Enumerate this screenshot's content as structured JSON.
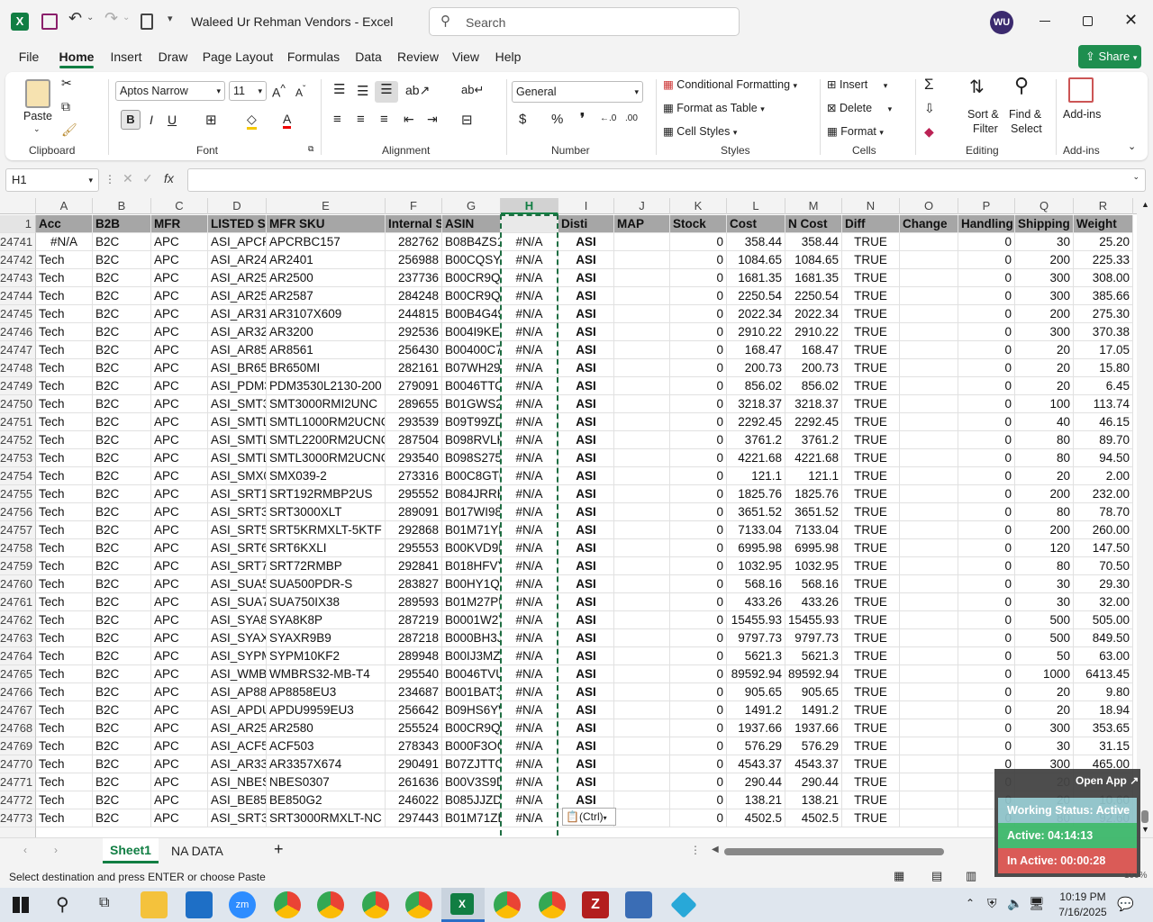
{
  "title": {
    "doc": "Waleed Ur Rehman Vendors  -  Excel",
    "search": "Search",
    "user": "WU"
  },
  "tabs": [
    "File",
    "Home",
    "Insert",
    "Draw",
    "Page Layout",
    "Formulas",
    "Data",
    "Review",
    "View",
    "Help"
  ],
  "share": "Share",
  "ribbon": {
    "clipboard": {
      "paste": "Paste",
      "label": "Clipboard"
    },
    "font": {
      "name": "Aptos Narrow",
      "size": "11",
      "label": "Font"
    },
    "alignment": {
      "label": "Alignment"
    },
    "number": {
      "format": "General",
      "label": "Number"
    },
    "styles": {
      "cond": "Conditional Formatting",
      "table": "Format as Table",
      "cell": "Cell Styles",
      "label": "Styles"
    },
    "cells": {
      "insert": "Insert",
      "delete": "Delete",
      "format": "Format",
      "label": "Cells"
    },
    "editing": {
      "sort1": "Sort &",
      "sort2": "Filter",
      "find1": "Find &",
      "find2": "Select",
      "label": "Editing"
    },
    "addins": {
      "name": "Add-ins",
      "label": "Add-ins"
    }
  },
  "namebox": "H1",
  "columns": [
    "A",
    "B",
    "C",
    "D",
    "E",
    "F",
    "G",
    "H",
    "I",
    "J",
    "K",
    "L",
    "M",
    "N",
    "O",
    "P",
    "Q",
    "R"
  ],
  "headers": [
    "Acc",
    "B2B",
    "MFR",
    "LISTED SK",
    "MFR SKU",
    "Internal S",
    "ASIN",
    "",
    "Disti",
    "MAP",
    "Stock",
    "Cost",
    "N Cost",
    "Diff",
    "Change",
    "Handling",
    "Shipping",
    "Weight"
  ],
  "rows": [
    [
      "24741",
      "#N/A",
      "B2C",
      "APC",
      "ASI_APCRI",
      "APCRBC157",
      "282762",
      "B08B4ZS14",
      "#N/A",
      "ASI",
      "",
      "0",
      "358.44",
      "358.44",
      "TRUE",
      "",
      "0",
      "30",
      "25.20"
    ],
    [
      "24742",
      "Tech",
      "B2C",
      "APC",
      "ASI_AR240",
      "AR2401",
      "256988",
      "B00CQSYV",
      "#N/A",
      "ASI",
      "",
      "0",
      "1084.65",
      "1084.65",
      "TRUE",
      "",
      "0",
      "200",
      "225.33"
    ],
    [
      "24743",
      "Tech",
      "B2C",
      "APC",
      "ASI_AR250",
      "AR2500",
      "237736",
      "B00CR9Q2",
      "#N/A",
      "ASI",
      "",
      "0",
      "1681.35",
      "1681.35",
      "TRUE",
      "",
      "0",
      "300",
      "308.00"
    ],
    [
      "24744",
      "Tech",
      "B2C",
      "APC",
      "ASI_AR258",
      "AR2587",
      "284248",
      "B00CR9Q4",
      "#N/A",
      "ASI",
      "",
      "0",
      "2250.54",
      "2250.54",
      "TRUE",
      "",
      "0",
      "300",
      "385.66"
    ],
    [
      "24745",
      "Tech",
      "B2C",
      "APC",
      "ASI_AR310",
      "AR3107X609",
      "244815",
      "B00B4G49",
      "#N/A",
      "ASI",
      "",
      "0",
      "2022.34",
      "2022.34",
      "TRUE",
      "",
      "0",
      "200",
      "275.30"
    ],
    [
      "24746",
      "Tech",
      "B2C",
      "APC",
      "ASI_AR320",
      "AR3200",
      "292536",
      "B004I9KEU",
      "#N/A",
      "ASI",
      "",
      "0",
      "2910.22",
      "2910.22",
      "TRUE",
      "",
      "0",
      "300",
      "370.38"
    ],
    [
      "24747",
      "Tech",
      "B2C",
      "APC",
      "ASI_AR856",
      "AR8561",
      "256430",
      "B00400C7",
      "#N/A",
      "ASI",
      "",
      "0",
      "168.47",
      "168.47",
      "TRUE",
      "",
      "0",
      "20",
      "17.05"
    ],
    [
      "24748",
      "Tech",
      "B2C",
      "APC",
      "ASI_BR650",
      "BR650MI",
      "282161",
      "B07WH29",
      "#N/A",
      "ASI",
      "",
      "0",
      "200.73",
      "200.73",
      "TRUE",
      "",
      "0",
      "20",
      "15.80"
    ],
    [
      "24749",
      "Tech",
      "B2C",
      "APC",
      "ASI_PDM3",
      "PDM3530L2130-200",
      "279091",
      "B0046TTO",
      "#N/A",
      "ASI",
      "",
      "0",
      "856.02",
      "856.02",
      "TRUE",
      "",
      "0",
      "20",
      "6.45"
    ],
    [
      "24750",
      "Tech",
      "B2C",
      "APC",
      "ASI_SMT30",
      "SMT3000RMI2UNC",
      "289655",
      "B01GWS2U",
      "#N/A",
      "ASI",
      "",
      "0",
      "3218.37",
      "3218.37",
      "TRUE",
      "",
      "0",
      "100",
      "113.74"
    ],
    [
      "24751",
      "Tech",
      "B2C",
      "APC",
      "ASI_SMTL1",
      "SMTL1000RM2UCNC",
      "293539",
      "B09T99ZD",
      "#N/A",
      "ASI",
      "",
      "0",
      "2292.45",
      "2292.45",
      "TRUE",
      "",
      "0",
      "40",
      "46.15"
    ],
    [
      "24752",
      "Tech",
      "B2C",
      "APC",
      "ASI_SMTL2",
      "SMTL2200RM2UCNC",
      "287504",
      "B098RVLH",
      "#N/A",
      "ASI",
      "",
      "0",
      "3761.2",
      "3761.2",
      "TRUE",
      "",
      "0",
      "80",
      "89.70"
    ],
    [
      "24753",
      "Tech",
      "B2C",
      "APC",
      "ASI_SMTL3",
      "SMTL3000RM2UCNC",
      "293540",
      "B098S2751",
      "#N/A",
      "ASI",
      "",
      "0",
      "4221.68",
      "4221.68",
      "TRUE",
      "",
      "0",
      "80",
      "94.50"
    ],
    [
      "24754",
      "Tech",
      "B2C",
      "APC",
      "ASI_SMX03",
      "SMX039-2",
      "273316",
      "B00C8GT0",
      "#N/A",
      "ASI",
      "",
      "0",
      "121.1",
      "121.1",
      "TRUE",
      "",
      "0",
      "20",
      "2.00"
    ],
    [
      "24755",
      "Tech",
      "B2C",
      "APC",
      "ASI_SRT19",
      "SRT192RMBP2US",
      "295552",
      "B084JRRH",
      "#N/A",
      "ASI",
      "",
      "0",
      "1825.76",
      "1825.76",
      "TRUE",
      "",
      "0",
      "200",
      "232.00"
    ],
    [
      "24756",
      "Tech",
      "B2C",
      "APC",
      "ASI_SRT30",
      "SRT3000XLT",
      "289091",
      "B017WI98",
      "#N/A",
      "ASI",
      "",
      "0",
      "3651.52",
      "3651.52",
      "TRUE",
      "",
      "0",
      "80",
      "78.70"
    ],
    [
      "24757",
      "Tech",
      "B2C",
      "APC",
      "ASI_SRT5K",
      "SRT5KRMXLT-5KTF",
      "292868",
      "B01M71YK",
      "#N/A",
      "ASI",
      "",
      "0",
      "7133.04",
      "7133.04",
      "TRUE",
      "",
      "0",
      "200",
      "260.00"
    ],
    [
      "24758",
      "Tech",
      "B2C",
      "APC",
      "ASI_SRT6K",
      "SRT6KXLI",
      "295553",
      "B00KVD9M",
      "#N/A",
      "ASI",
      "",
      "0",
      "6995.98",
      "6995.98",
      "TRUE",
      "",
      "0",
      "120",
      "147.50"
    ],
    [
      "24759",
      "Tech",
      "B2C",
      "APC",
      "ASI_SRT72",
      "SRT72RMBP",
      "292841",
      "B018HFVY",
      "#N/A",
      "ASI",
      "",
      "0",
      "1032.95",
      "1032.95",
      "TRUE",
      "",
      "0",
      "80",
      "70.50"
    ],
    [
      "24760",
      "Tech",
      "B2C",
      "APC",
      "ASI_SUA50",
      "SUA500PDR-S",
      "283827",
      "B00HY1QV",
      "#N/A",
      "ASI",
      "",
      "0",
      "568.16",
      "568.16",
      "TRUE",
      "",
      "0",
      "30",
      "29.30"
    ],
    [
      "24761",
      "Tech",
      "B2C",
      "APC",
      "ASI_SUA75",
      "SUA750IX38",
      "289593",
      "B01M27PU",
      "#N/A",
      "ASI",
      "",
      "0",
      "433.26",
      "433.26",
      "TRUE",
      "",
      "0",
      "30",
      "32.00"
    ],
    [
      "24762",
      "Tech",
      "B2C",
      "APC",
      "ASI_SYA8K",
      "SYA8K8P",
      "287219",
      "B0001W2Y",
      "#N/A",
      "ASI",
      "",
      "0",
      "15455.93",
      "15455.93",
      "TRUE",
      "",
      "0",
      "500",
      "505.00"
    ],
    [
      "24763",
      "Tech",
      "B2C",
      "APC",
      "ASI_SYAXR",
      "SYAXR9B9",
      "287218",
      "B000BH3J4",
      "#N/A",
      "ASI",
      "",
      "0",
      "9797.73",
      "9797.73",
      "TRUE",
      "",
      "0",
      "500",
      "849.50"
    ],
    [
      "24764",
      "Tech",
      "B2C",
      "APC",
      "ASI_SYPM1",
      "SYPM10KF2",
      "289948",
      "B00IJ3MZG",
      "#N/A",
      "ASI",
      "",
      "0",
      "5621.3",
      "5621.3",
      "TRUE",
      "",
      "0",
      "50",
      "63.00"
    ],
    [
      "24765",
      "Tech",
      "B2C",
      "APC",
      "ASI_WMBF",
      "WMBRS32-MB-T4",
      "295540",
      "B0046TVU",
      "#N/A",
      "ASI",
      "",
      "0",
      "89592.94",
      "89592.94",
      "TRUE",
      "",
      "0",
      "1000",
      "6413.45"
    ],
    [
      "24766",
      "Tech",
      "B2C",
      "APC",
      "ASI_AP885",
      "AP8858EU3",
      "234687",
      "B001BAT39",
      "#N/A",
      "ASI",
      "",
      "0",
      "905.65",
      "905.65",
      "TRUE",
      "",
      "0",
      "20",
      "9.80"
    ],
    [
      "24767",
      "Tech",
      "B2C",
      "APC",
      "ASI_APDU9",
      "APDU9959EU3",
      "256642",
      "B09HS6YW",
      "#N/A",
      "ASI",
      "",
      "0",
      "1491.2",
      "1491.2",
      "TRUE",
      "",
      "0",
      "20",
      "18.94"
    ],
    [
      "24768",
      "Tech",
      "B2C",
      "APC",
      "ASI_AR258",
      "AR2580",
      "255524",
      "B00CR9Q6",
      "#N/A",
      "ASI",
      "",
      "0",
      "1937.66",
      "1937.66",
      "TRUE",
      "",
      "0",
      "300",
      "353.65"
    ],
    [
      "24769",
      "Tech",
      "B2C",
      "APC",
      "ASI_ACF50",
      "ACF503",
      "278343",
      "B000F3OG",
      "#N/A",
      "ASI",
      "",
      "0",
      "576.29",
      "576.29",
      "TRUE",
      "",
      "0",
      "30",
      "31.15"
    ],
    [
      "24770",
      "Tech",
      "B2C",
      "APC",
      "ASI_AR335",
      "AR3357X674",
      "290491",
      "B07ZJTTG",
      "#N/A",
      "ASI",
      "",
      "0",
      "4543.37",
      "4543.37",
      "TRUE",
      "",
      "0",
      "300",
      "465.00"
    ],
    [
      "24771",
      "Tech",
      "B2C",
      "APC",
      "ASI_NBES0",
      "NBES0307",
      "261636",
      "B00V3S9D",
      "#N/A",
      "ASI",
      "",
      "0",
      "290.44",
      "290.44",
      "TRUE",
      "",
      "0",
      "20",
      ""
    ],
    [
      "24772",
      "Tech",
      "B2C",
      "APC",
      "ASI_BE850",
      "BE850G2",
      "246022",
      "B085JJZDF",
      "#N/A",
      "ASI",
      "",
      "0",
      "138.21",
      "138.21",
      "TRUE",
      "",
      "0",
      "20",
      "10.60"
    ],
    [
      "24773",
      "Tech",
      "B2C",
      "APC",
      "ASI_SRT30",
      "SRT3000RMXLT-NC",
      "297443",
      "B01M71ZL",
      "#N/A",
      "",
      "",
      "0",
      "4502.5",
      "4502.5",
      "TRUE",
      "",
      "0",
      "80",
      "92.60"
    ]
  ],
  "pasteTag": "(Ctrl)",
  "sheets": [
    "Sheet1",
    "NA DATA"
  ],
  "status": "Select destination and press ENTER or choose Paste",
  "zoom": "100%",
  "widget": {
    "open": "Open App",
    "working": "Working Status: Active",
    "active": "Active: 04:14:13",
    "inactive": "In Active: 00:00:28"
  },
  "clock": {
    "time": "10:19 PM",
    "date": "7/16/2025"
  },
  "colors": {
    "excel": "#117e43",
    "share": "#1e8e4f"
  }
}
